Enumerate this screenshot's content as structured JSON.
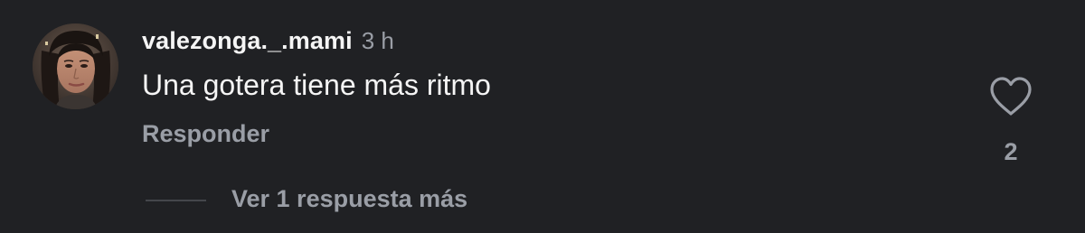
{
  "comment": {
    "avatar": "user-avatar-photo",
    "username": "valezonga._.mami",
    "time": "3 h",
    "text": "Una gotera tiene más ritmo",
    "reply_label": "Responder",
    "like_icon": "heart-outline-icon",
    "like_count": "2",
    "view_more_label": "Ver 1 respuesta más"
  },
  "colors": {
    "background": "#202124",
    "primary_text": "#f5f5f5",
    "secondary_text": "#9a9ea6",
    "divider": "#44464b"
  }
}
